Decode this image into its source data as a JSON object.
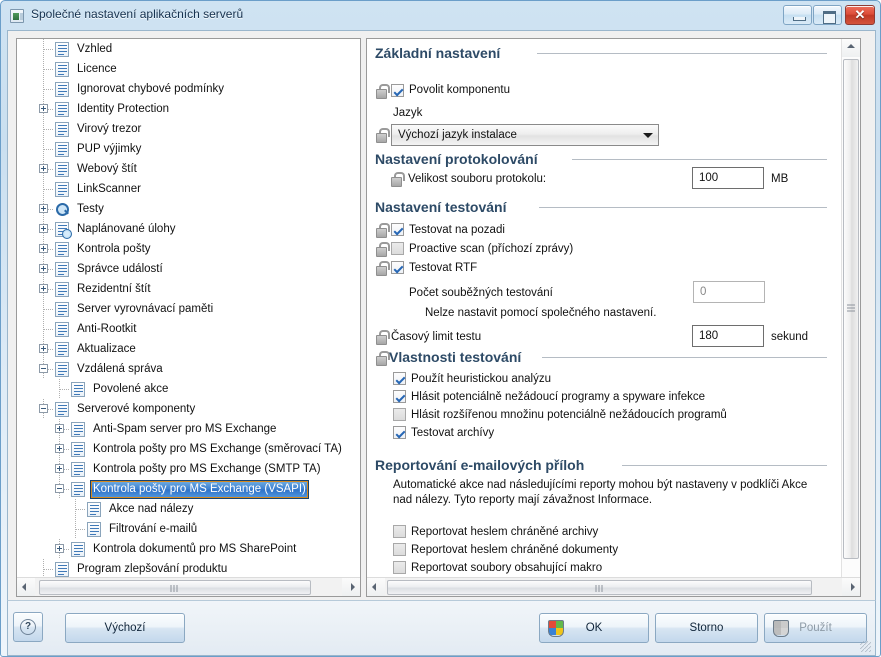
{
  "window": {
    "title": "Společné nastavení aplikačních serverů",
    "icon": "app-window-icon",
    "minimize_label": "Minimalizovat",
    "maximize_label": "Maximalizovat",
    "close_label": "Zavřít"
  },
  "tree": {
    "items": [
      {
        "label": "Vzhled",
        "indent": 1,
        "toggle": "none",
        "icon": "settings-page-icon"
      },
      {
        "label": "Licence",
        "indent": 1,
        "toggle": "none",
        "icon": "settings-page-icon"
      },
      {
        "label": "Ignorovat chybové podmínky",
        "indent": 1,
        "toggle": "none",
        "icon": "settings-page-icon"
      },
      {
        "label": "Identity Protection",
        "indent": 1,
        "toggle": "expand",
        "icon": "settings-page-icon"
      },
      {
        "label": "Virový trezor",
        "indent": 1,
        "toggle": "none",
        "icon": "settings-page-icon"
      },
      {
        "label": "PUP výjimky",
        "indent": 1,
        "toggle": "none",
        "icon": "settings-page-icon"
      },
      {
        "label": "Webový štít",
        "indent": 1,
        "toggle": "expand",
        "icon": "settings-page-icon"
      },
      {
        "label": "LinkScanner",
        "indent": 1,
        "toggle": "none",
        "icon": "settings-page-icon"
      },
      {
        "label": "Testy",
        "indent": 1,
        "toggle": "expand",
        "icon": "magnifier-icon"
      },
      {
        "label": "Naplánované úlohy",
        "indent": 1,
        "toggle": "expand",
        "icon": "scheduled-tasks-icon"
      },
      {
        "label": "Kontrola pošty",
        "indent": 1,
        "toggle": "expand",
        "icon": "settings-page-icon"
      },
      {
        "label": "Správce událostí",
        "indent": 1,
        "toggle": "expand",
        "icon": "settings-page-icon"
      },
      {
        "label": "Rezidentní štít",
        "indent": 1,
        "toggle": "expand",
        "icon": "settings-page-icon"
      },
      {
        "label": "Server vyrovnávací paměti",
        "indent": 1,
        "toggle": "none",
        "icon": "settings-page-icon"
      },
      {
        "label": "Anti-Rootkit",
        "indent": 1,
        "toggle": "none",
        "icon": "settings-page-icon"
      },
      {
        "label": "Aktualizace",
        "indent": 1,
        "toggle": "expand",
        "icon": "settings-page-icon"
      },
      {
        "label": "Vzdálená správa",
        "indent": 1,
        "toggle": "collapse",
        "icon": "settings-page-icon"
      },
      {
        "label": "Povolené akce",
        "indent": 2,
        "toggle": "none",
        "icon": "settings-page-icon"
      },
      {
        "label": "Serverové komponenty",
        "indent": 1,
        "toggle": "collapse",
        "icon": "settings-page-icon"
      },
      {
        "label": "Anti-Spam server pro MS Exchange",
        "indent": 2,
        "toggle": "expand",
        "icon": "settings-page-icon"
      },
      {
        "label": "Kontrola pošty pro MS Exchange (směrovací TA)",
        "indent": 2,
        "toggle": "expand",
        "icon": "settings-page-icon"
      },
      {
        "label": "Kontrola pošty pro MS Exchange (SMTP TA)",
        "indent": 2,
        "toggle": "expand",
        "icon": "settings-page-icon"
      },
      {
        "label": "Kontrola pošty pro MS Exchange (VSAPI)",
        "indent": 2,
        "toggle": "collapse",
        "icon": "settings-page-icon",
        "selected": true
      },
      {
        "label": "Akce nad nálezy",
        "indent": 3,
        "toggle": "none",
        "icon": "settings-page-icon"
      },
      {
        "label": "Filtrování e-mailů",
        "indent": 3,
        "toggle": "none",
        "icon": "settings-page-icon"
      },
      {
        "label": "Kontrola dokumentů pro MS SharePoint",
        "indent": 2,
        "toggle": "expand",
        "icon": "settings-page-icon"
      },
      {
        "label": "Program zlepšování produktu",
        "indent": 1,
        "toggle": "none",
        "icon": "settings-page-icon"
      }
    ],
    "scrollbar": {
      "left_arrow": "scroll-left",
      "right_arrow": "scroll-right"
    }
  },
  "settings": {
    "groups": {
      "basic": "Základní nastavení",
      "logging": "Nastavení protokolování",
      "scanning": "Nastavení testování",
      "properties": "Vlastnosti testování",
      "reporting": "Reportování e-mailových příloh"
    },
    "enable_component": {
      "label": "Povolit komponentu",
      "checked": true,
      "locked": true
    },
    "language": {
      "label": "Jazyk",
      "value": "Výchozí jazyk instalace",
      "locked": true
    },
    "log_size": {
      "label": "Velikost souboru protokolu:",
      "value": "100",
      "unit": "MB",
      "locked": true
    },
    "scan_background": {
      "label": "Testovat na pozadi",
      "checked": true,
      "locked": true
    },
    "proactive_scan": {
      "label": "Proactive scan (příchozí zprávy)",
      "checked": false,
      "locked": true
    },
    "scan_rtf": {
      "label": "Testovat RTF",
      "checked": true,
      "locked": true
    },
    "concurrent_scans": {
      "label": "Počet souběžných testování",
      "value": "0",
      "disabled": true,
      "note": "Nelze nastavit pomocí společného nastavení."
    },
    "scan_timeout": {
      "label": "Časový limit testu",
      "value": "180",
      "unit": "sekund",
      "locked": true
    },
    "properties_locked": true,
    "property_checks": [
      {
        "label": "Použít heuristickou analýzu",
        "checked": true
      },
      {
        "label": "Hlásit potenciálně nežádoucí programy a spyware infekce",
        "checked": true
      },
      {
        "label": "Hlásit rozšířenou množinu potenciálně nežádoucích programů",
        "checked": false
      },
      {
        "label": "Testovat archívy",
        "checked": true
      }
    ],
    "reporting_note_line1": "Automatické akce nad následujícími reporty mohou být nastaveny v podklíči Akce",
    "reporting_note_line2": "nad nálezy. Tyto reporty mají závažnost Informace.",
    "reporting_checks": [
      {
        "label": "Reportovat heslem chráněné archivy",
        "checked": false
      },
      {
        "label": "Reportovat heslem chráněné dokumenty",
        "checked": false
      },
      {
        "label": "Reportovat soubory obsahující makro",
        "checked": false
      }
    ]
  },
  "footer": {
    "help_label": "?",
    "default_button": "Výchozí",
    "ok_button": "OK",
    "cancel_button": "Storno",
    "apply_button": "Použít",
    "apply_disabled": true
  }
}
